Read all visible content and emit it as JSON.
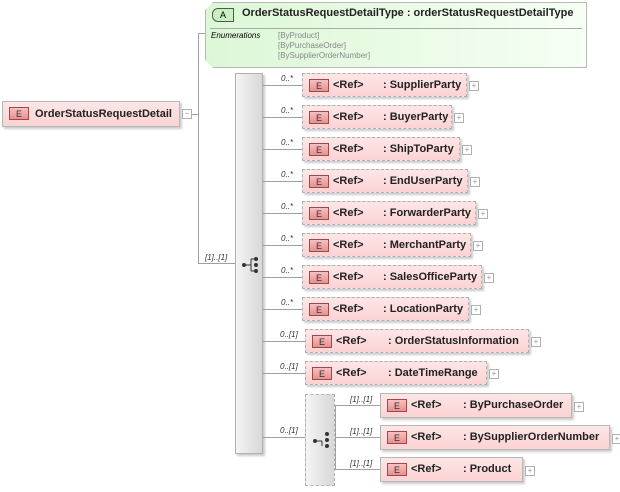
{
  "attribute": {
    "badge": "A",
    "title": "OrderStatusRequestDetailType : orderStatusRequestDetailType",
    "enum_label": "Enumerations",
    "enums": [
      "[ByProduct]",
      "[ByPurchaseOrder]",
      "[BySupplierOrderNumber]"
    ]
  },
  "root": {
    "badge": "E",
    "name": "OrderStatusRequestDetail",
    "collapse": "−"
  },
  "sequence": {
    "cardinality": "[1]..[1]"
  },
  "children": [
    {
      "card": "0..*",
      "ref": "<Ref>",
      "name": ": SupplierParty"
    },
    {
      "card": "0..*",
      "ref": "<Ref>",
      "name": ": BuyerParty"
    },
    {
      "card": "0..*",
      "ref": "<Ref>",
      "name": ": ShipToParty"
    },
    {
      "card": "0..*",
      "ref": "<Ref>",
      "name": ": EndUserParty"
    },
    {
      "card": "0..*",
      "ref": "<Ref>",
      "name": ": ForwarderParty"
    },
    {
      "card": "0..*",
      "ref": "<Ref>",
      "name": ": MerchantParty"
    },
    {
      "card": "0..*",
      "ref": "<Ref>",
      "name": ": SalesOfficeParty"
    },
    {
      "card": "0..*",
      "ref": "<Ref>",
      "name": ": LocationParty"
    },
    {
      "card": "0..[1]",
      "ref": "<Ref>",
      "name": ": OrderStatusInformation"
    },
    {
      "card": "0..[1]",
      "ref": "<Ref>",
      "name": ": DateTimeRange"
    }
  ],
  "choice": {
    "card": "0..[1]",
    "children": [
      {
        "card": "[1]..[1]",
        "ref": "<Ref>",
        "name": ": ByPurchaseOrder"
      },
      {
        "card": "[1]..[1]",
        "ref": "<Ref>",
        "name": ": BySupplierOrderNumber"
      },
      {
        "card": "[1]..[1]",
        "ref": "<Ref>",
        "name": ": Product"
      }
    ]
  },
  "badge": "E",
  "plus": "+"
}
